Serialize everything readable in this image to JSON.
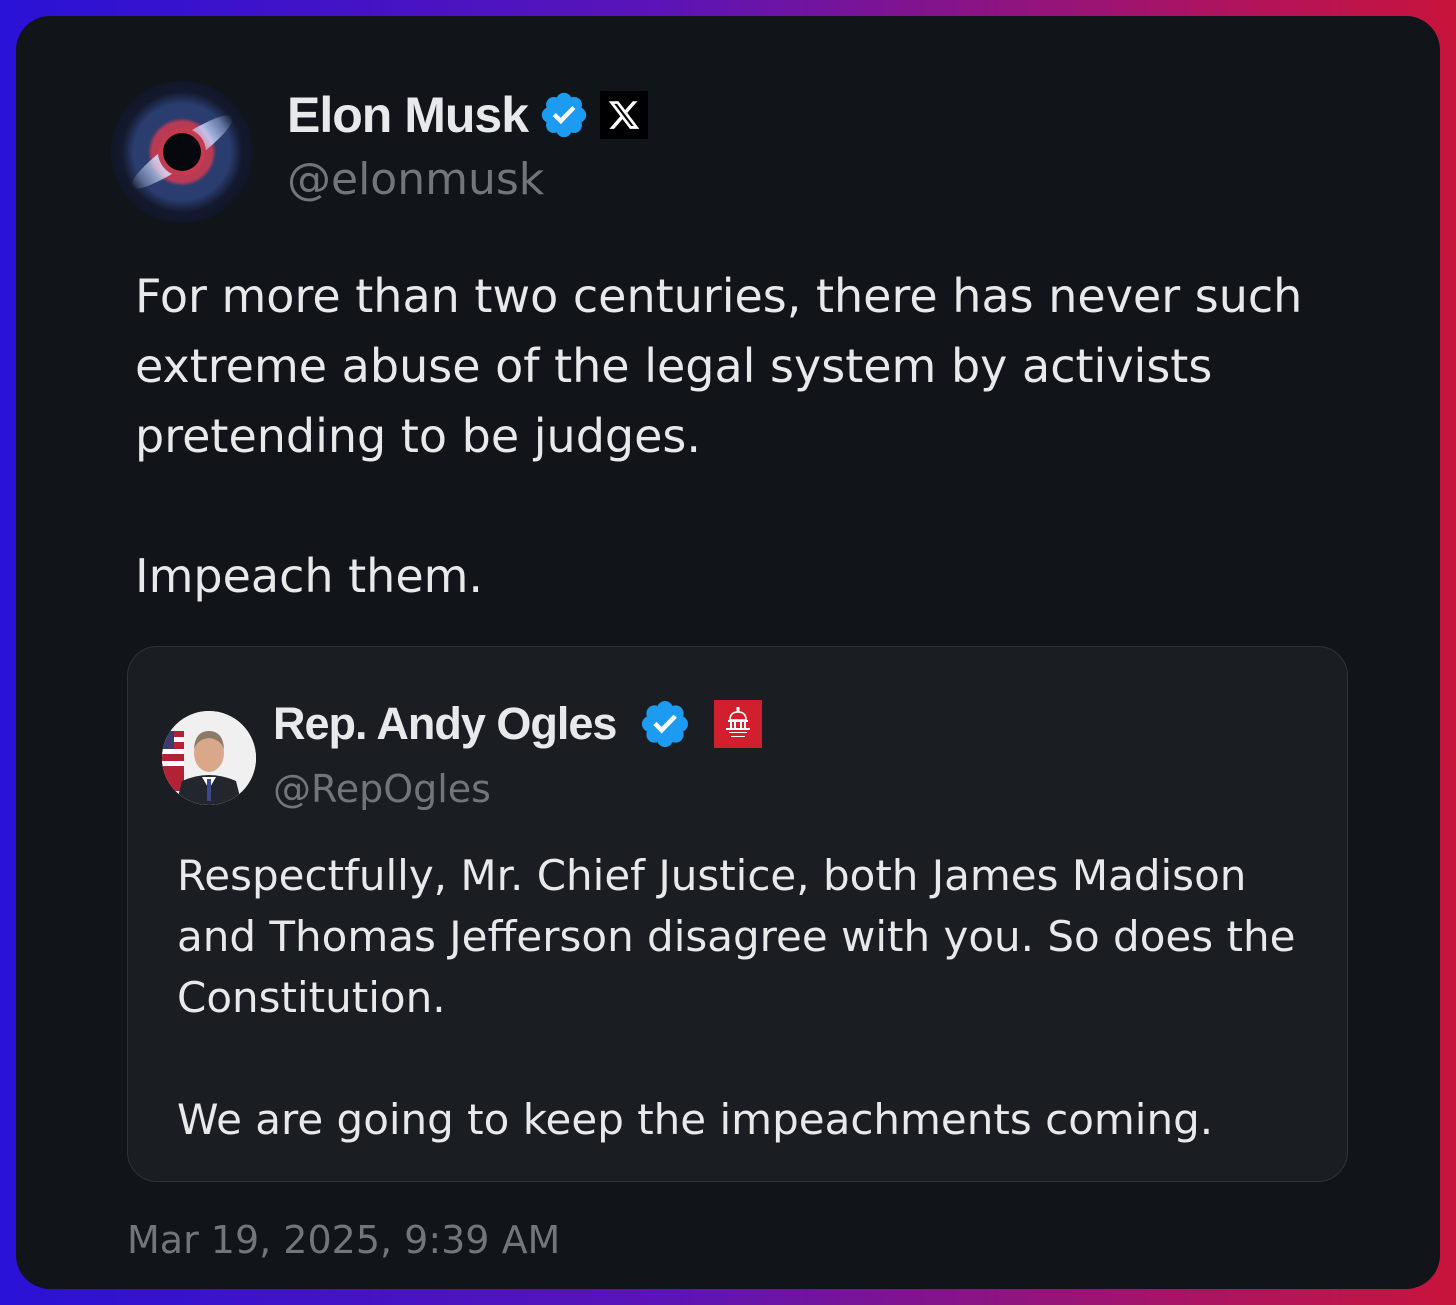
{
  "tweet": {
    "author_name": "Elon Musk",
    "author_handle": "@elonmusk",
    "paragraphs": [
      "For more than two centuries, there has never such extreme abuse of the legal system by activists pretending to be judges.",
      "Impeach them."
    ],
    "timestamp": "Mar 19, 2025, 9:39 AM",
    "badges": [
      "verified-icon",
      "x-logo-icon"
    ]
  },
  "quoted_tweet": {
    "author_name": "Rep. Andy Ogles",
    "author_handle": "@RepOgles",
    "paragraphs": [
      "Respectfully, Mr. Chief Justice, both James Madison and Thomas Jefferson disagree with you. So does the Constitution.",
      "We are going to keep the impeachments coming."
    ],
    "badges": [
      "verified-icon",
      "house-gop-logo-icon"
    ],
    "affiliation_logo_text": "HOUSE GOP"
  },
  "colors": {
    "card_background": "#111418",
    "quote_background": "#1a1d21",
    "text_primary": "#e7e9ea",
    "text_secondary": "#71767b",
    "verified_blue": "#1d9bf0",
    "gop_red": "#d0202e"
  }
}
